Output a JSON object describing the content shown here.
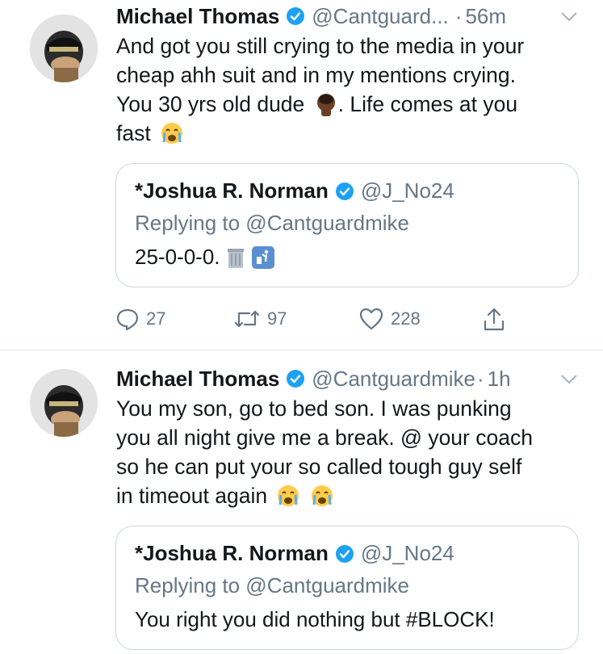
{
  "colors": {
    "name": "#14171a",
    "secondary": "#657786",
    "verified": "#1da1f2",
    "border": "#ccd6dd"
  },
  "tweets": [
    {
      "author": "Michael Thomas",
      "handle": "@Cantguard...",
      "time": "56m",
      "dot": "·",
      "body_lines": [
        "And got you still crying to the media in your",
        "cheap ahh suit and in my mentions crying.",
        "You 30 yrs old dude",
        ". Life comes at you",
        "fast"
      ],
      "quote": {
        "author": "*Joshua R. Norman",
        "handle": "@J_No24",
        "replying": "Replying to @Cantguardmike",
        "text": "25-0-0-0."
      },
      "replies": "27",
      "retweets": "97",
      "likes": "228"
    },
    {
      "author": "Michael Thomas",
      "handle": "@Cantguardmike",
      "time": "1h",
      "dot": "·",
      "body_lines": [
        "You my son, go to bed son. I was punking",
        "you all night give me a break. @ your coach",
        "so he can put your so called tough guy self",
        "in timeout again"
      ],
      "quote": {
        "author": "*Joshua R. Norman",
        "handle": "@J_No24",
        "replying": "Replying to @Cantguardmike",
        "text": "You right you did nothing but #BLOCK!"
      }
    }
  ]
}
